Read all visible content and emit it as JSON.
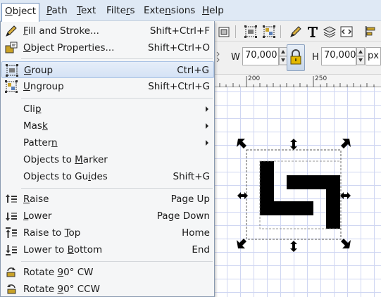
{
  "menubar": {
    "items": [
      {
        "pre": "",
        "key": "O",
        "post": "bject"
      },
      {
        "pre": "",
        "key": "P",
        "post": "ath"
      },
      {
        "pre": "",
        "key": "T",
        "post": "ext"
      },
      {
        "pre": "Filte",
        "key": "r",
        "post": "s"
      },
      {
        "pre": "Exte",
        "key": "n",
        "post": "sions"
      },
      {
        "pre": "",
        "key": "H",
        "post": "elp"
      }
    ]
  },
  "menu": {
    "items": [
      {
        "icon": "fill-stroke-icon",
        "pre": "",
        "key": "F",
        "post": "ill and Stroke...",
        "shortcut": "Shift+Ctrl+F"
      },
      {
        "icon": "object-properties-icon",
        "pre": "",
        "key": "O",
        "post": "bject Properties...",
        "shortcut": "Shift+Ctrl+O"
      },
      {
        "icon": "group-icon",
        "pre": "",
        "key": "G",
        "post": "roup",
        "shortcut": "Ctrl+G"
      },
      {
        "icon": "ungroup-icon",
        "pre": "",
        "key": "U",
        "post": "ngroup",
        "shortcut": "Shift+Ctrl+G"
      },
      {
        "icon": "",
        "pre": "Cli",
        "key": "p",
        "post": "",
        "shortcut": ""
      },
      {
        "icon": "",
        "pre": "Mas",
        "key": "k",
        "post": "",
        "shortcut": ""
      },
      {
        "icon": "",
        "pre": "Patter",
        "key": "n",
        "post": "",
        "shortcut": ""
      },
      {
        "icon": "",
        "pre": "Objects to ",
        "key": "M",
        "post": "arker",
        "shortcut": ""
      },
      {
        "icon": "",
        "pre": "Objects to Gu",
        "key": "i",
        "post": "des",
        "shortcut": "Shift+G"
      },
      {
        "icon": "raise-icon",
        "pre": "",
        "key": "R",
        "post": "aise",
        "shortcut": "Page Up"
      },
      {
        "icon": "lower-icon",
        "pre": "",
        "key": "L",
        "post": "ower",
        "shortcut": "Page Down"
      },
      {
        "icon": "raise-to-top-icon",
        "pre": "Raise to ",
        "key": "T",
        "post": "op",
        "shortcut": "Home"
      },
      {
        "icon": "lower-to-bottom-icon",
        "pre": "Lower to ",
        "key": "B",
        "post": "ottom",
        "shortcut": "End"
      },
      {
        "icon": "rotate-cw-icon",
        "pre": "Rotate ",
        "key": "9",
        "post": "0° CW",
        "shortcut": ""
      },
      {
        "icon": "rotate-ccw-icon",
        "pre": "Rotate ",
        "key": "9",
        "post": "0° CCW",
        "shortcut": ""
      }
    ]
  },
  "toolbar": {
    "w_label": "W",
    "w_value": "70,000",
    "h_label": "H",
    "h_value": "70,000",
    "unit": "px"
  },
  "ruler": {
    "labels": [
      "200",
      "250"
    ]
  }
}
